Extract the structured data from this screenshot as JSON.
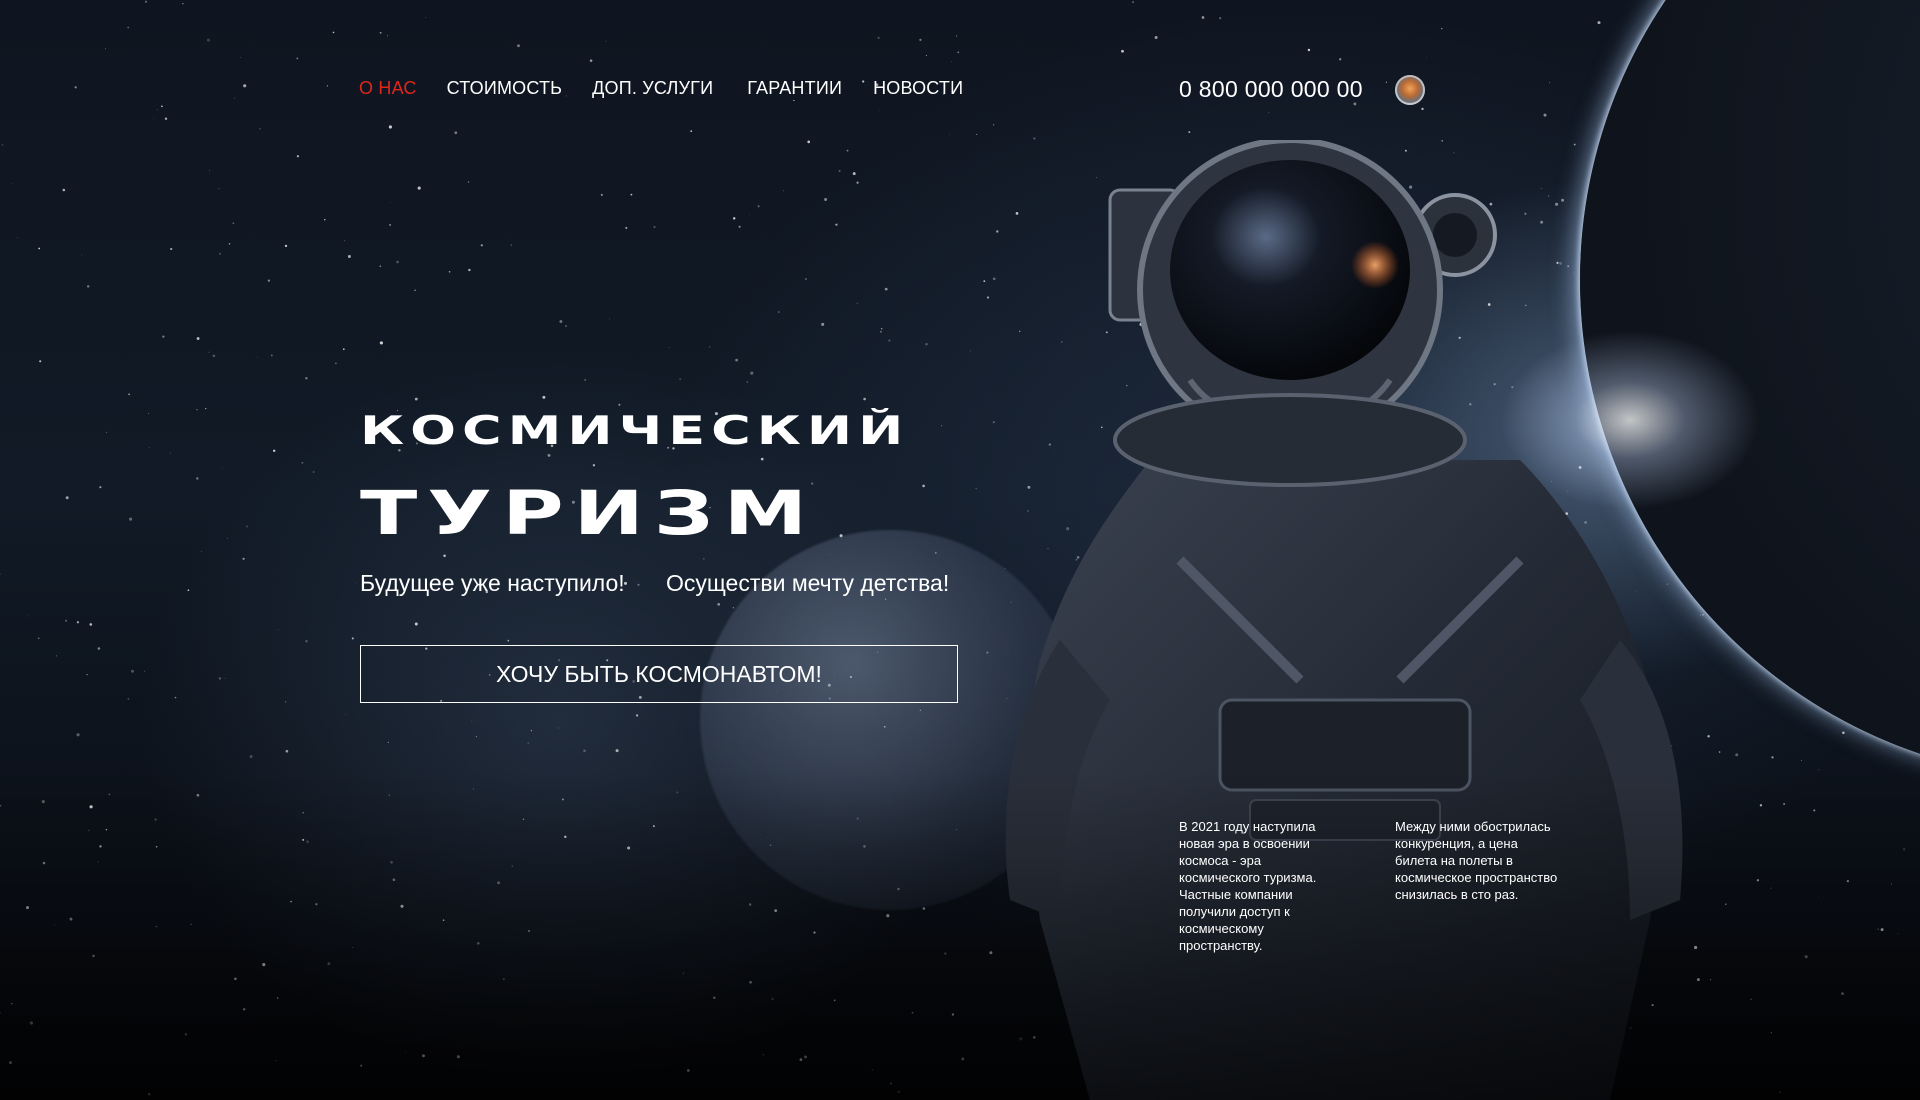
{
  "header": {
    "nav": [
      {
        "label": "О НАС",
        "active": true
      },
      {
        "label": "СТОИМОСТЬ",
        "active": false
      },
      {
        "label": "ДОП. УСЛУГИ",
        "active": false
      },
      {
        "label": "ГАРАНТИИ",
        "active": false
      },
      {
        "label": "НОВОСТИ",
        "active": false
      }
    ],
    "phone": "0 800 000 000 00",
    "avatar_icon": "user-avatar-icon"
  },
  "hero": {
    "title_line1": "КОСМИЧЕСКИЙ",
    "title_line2": "ТУРИЗМ",
    "subtitle_left": "Будущее уже наступило!",
    "subtitle_right": "Осуществи мечту детства!",
    "cta_label": "ХОЧУ БЫТЬ КОСМОНАВТОМ!"
  },
  "info": {
    "col1": "В 2021 году наступила новая эра в освоении космоса - эра космического туризма. Частные компании получили доступ к космическому пространству.",
    "col2": "Между ними обострилась конкуренция, а цена билета на полеты в космическое пространство снизилась в сто раз."
  },
  "colors": {
    "accent": "#e1251b",
    "text": "#ffffff",
    "background": "#0f1520"
  }
}
